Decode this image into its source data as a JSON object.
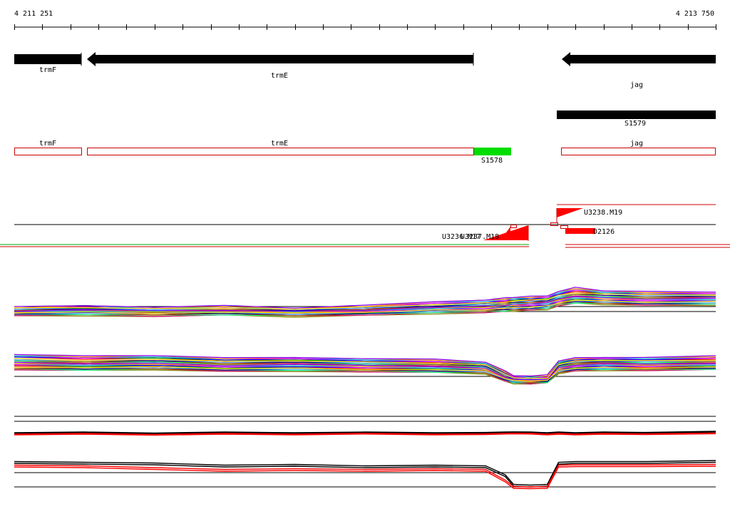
{
  "coordinate_axis": {
    "start_label": "4 211 251",
    "end_label": "4 213 750",
    "start": 4211251,
    "end": 4213750
  },
  "genes_minus_strand": [
    {
      "label": "trmF",
      "start": 4211251,
      "end": 4211490,
      "strand": "-"
    },
    {
      "label": "trmE",
      "start": 4211509,
      "end": 4212893,
      "strand": "-"
    },
    {
      "label": "jag",
      "start": 4213192,
      "end": 4213750,
      "strand": "-"
    }
  ],
  "segments_black": [
    {
      "label": "S1579",
      "start": 4213176,
      "end": 4213750
    }
  ],
  "annotation_boxes": [
    {
      "label": "trmF",
      "start": 4211251,
      "end": 4211490,
      "style": "outline"
    },
    {
      "label": "trmE",
      "start": 4211509,
      "end": 4212893,
      "style": "outline"
    },
    {
      "label": "S1578",
      "start": 4212893,
      "end": 4213026,
      "style": "filled"
    },
    {
      "label": "jag",
      "start": 4213192,
      "end": 4213750,
      "style": "outline"
    }
  ],
  "feature_labels": {
    "u3238": "U3238.M19",
    "overlap_a": "U3236.M17",
    "overlap_b": "U3237.M18",
    "d2126": "D2126"
  },
  "colors": {
    "gene": "#000000",
    "box_outline": "#cc0000",
    "s1578": "#00dd00",
    "feature_red": "#ff0000"
  },
  "chart_data": {
    "type": "line",
    "title": "",
    "xlabel": "",
    "ylabel": "",
    "xlim": [
      4211251,
      4213750
    ],
    "x": [
      4211251,
      4211500,
      4211750,
      4212000,
      4212250,
      4212500,
      4212750,
      4212930,
      4213000,
      4213030,
      4213090,
      4213150,
      4213190,
      4213250,
      4213350,
      4213500,
      4213750
    ],
    "series": [
      {
        "group": "upper",
        "values": [
          0.48,
          0.52,
          0.47,
          0.5,
          0.46,
          0.51,
          0.6,
          0.62,
          0.66,
          0.68,
          0.7,
          0.72,
          0.8,
          0.88,
          0.82,
          0.8,
          0.8
        ]
      },
      {
        "group": "upper",
        "values": [
          0.45,
          0.47,
          0.44,
          0.46,
          0.43,
          0.47,
          0.53,
          0.56,
          0.58,
          0.6,
          0.62,
          0.64,
          0.72,
          0.78,
          0.75,
          0.73,
          0.73
        ]
      },
      {
        "group": "upper",
        "values": [
          0.4,
          0.42,
          0.39,
          0.41,
          0.38,
          0.42,
          0.47,
          0.49,
          0.51,
          0.53,
          0.55,
          0.57,
          0.64,
          0.7,
          0.67,
          0.65,
          0.66
        ]
      },
      {
        "group": "upper",
        "values": [
          0.36,
          0.37,
          0.35,
          0.37,
          0.34,
          0.37,
          0.41,
          0.43,
          0.45,
          0.46,
          0.48,
          0.5,
          0.57,
          0.62,
          0.6,
          0.58,
          0.59
        ]
      },
      {
        "group": "lower",
        "values": [
          0.7,
          0.66,
          0.68,
          0.62,
          0.64,
          0.6,
          0.58,
          0.52,
          0.3,
          0.2,
          0.18,
          0.2,
          0.55,
          0.62,
          0.64,
          0.63,
          0.66
        ]
      },
      {
        "group": "lower",
        "values": [
          0.6,
          0.56,
          0.58,
          0.53,
          0.55,
          0.52,
          0.5,
          0.45,
          0.22,
          0.14,
          0.12,
          0.14,
          0.46,
          0.54,
          0.56,
          0.55,
          0.57
        ]
      },
      {
        "group": "lower",
        "values": [
          0.5,
          0.47,
          0.49,
          0.44,
          0.46,
          0.43,
          0.41,
          0.37,
          0.16,
          0.1,
          0.08,
          0.1,
          0.38,
          0.45,
          0.47,
          0.46,
          0.48
        ]
      },
      {
        "group": "lower",
        "values": [
          0.4,
          0.38,
          0.4,
          0.36,
          0.37,
          0.35,
          0.33,
          0.3,
          0.12,
          0.07,
          0.06,
          0.08,
          0.31,
          0.37,
          0.39,
          0.38,
          0.4
        ]
      }
    ],
    "summary_series": [
      {
        "group": "upper",
        "color": "#000000",
        "values": [
          0.5,
          0.55,
          0.48,
          0.55,
          0.5,
          0.55,
          0.5,
          0.52,
          0.55,
          0.56,
          0.55,
          0.5,
          0.55,
          0.5,
          0.55,
          0.52,
          0.6
        ]
      },
      {
        "group": "upper",
        "color": "#ff0000",
        "values": [
          0.4,
          0.45,
          0.38,
          0.45,
          0.4,
          0.46,
          0.4,
          0.42,
          0.46,
          0.47,
          0.46,
          0.4,
          0.45,
          0.4,
          0.45,
          0.42,
          0.48
        ]
      },
      {
        "group": "lower",
        "color": "#000000",
        "values": [
          0.72,
          0.7,
          0.68,
          0.62,
          0.64,
          0.6,
          0.62,
          0.6,
          0.35,
          0.08,
          0.06,
          0.08,
          0.7,
          0.72,
          0.72,
          0.72,
          0.75
        ]
      },
      {
        "group": "lower",
        "color": "#ff0000",
        "values": [
          0.62,
          0.6,
          0.55,
          0.5,
          0.52,
          0.5,
          0.52,
          0.5,
          0.2,
          0.02,
          0.01,
          0.02,
          0.62,
          0.63,
          0.63,
          0.63,
          0.64
        ]
      }
    ],
    "series_colors": [
      "#ff0000",
      "#00aa00",
      "#0000ff",
      "#ff00ff",
      "#00cccc",
      "#ff8800",
      "#8800ff",
      "#888800",
      "#cc0066",
      "#00ff88",
      "#aa5500",
      "#000088",
      "#66ccff",
      "#ffcc00"
    ],
    "grid": false,
    "legend": "none"
  }
}
